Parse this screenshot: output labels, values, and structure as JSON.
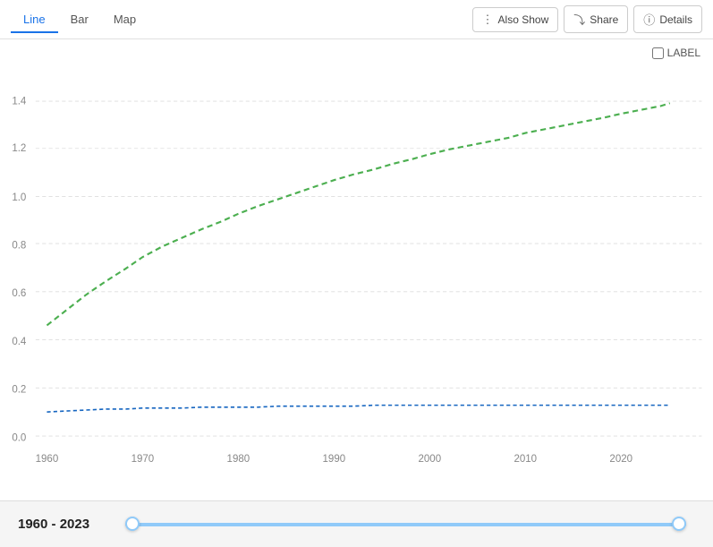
{
  "tabs": [
    {
      "label": "Line",
      "active": true
    },
    {
      "label": "Bar",
      "active": false
    },
    {
      "label": "Map",
      "active": false
    }
  ],
  "toolbar": {
    "also_show_label": "Also Show",
    "share_label": "Share",
    "details_label": "Details"
  },
  "chart": {
    "label_checkbox_text": "LABEL",
    "y_axis": [
      "1.4",
      "1.2",
      "1.0",
      "0.8",
      "0.6",
      "0.4",
      "0.2",
      "0.0"
    ],
    "x_axis": [
      "1960",
      "1970",
      "1980",
      "1990",
      "2000",
      "2010",
      "2020"
    ]
  },
  "bottom_bar": {
    "year_range": "1960 - 2023"
  }
}
